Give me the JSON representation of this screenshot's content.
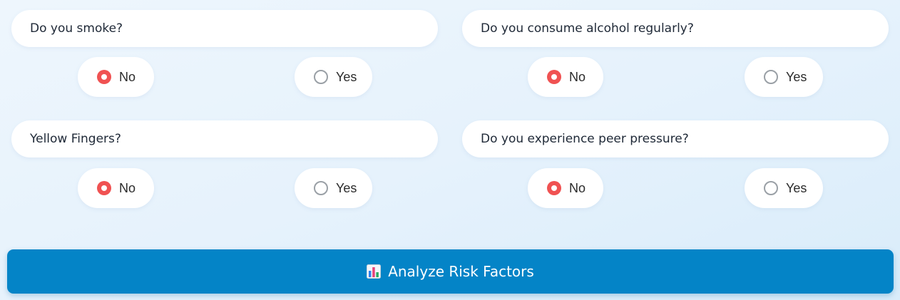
{
  "questions": [
    {
      "label": "Do you smoke?",
      "options": [
        {
          "label": "No",
          "checked": true
        },
        {
          "label": "Yes",
          "checked": false
        }
      ]
    },
    {
      "label": "Do you consume alcohol regularly?",
      "options": [
        {
          "label": "No",
          "checked": true
        },
        {
          "label": "Yes",
          "checked": false
        }
      ]
    },
    {
      "label": "Yellow Fingers?",
      "options": [
        {
          "label": "No",
          "checked": true
        },
        {
          "label": "Yes",
          "checked": false
        }
      ]
    },
    {
      "label": "Do you experience peer pressure?",
      "options": [
        {
          "label": "No",
          "checked": true
        },
        {
          "label": "Yes",
          "checked": false
        }
      ]
    }
  ],
  "analyze_button": {
    "label": "Analyze Risk Factors",
    "icon": "bar-chart-icon"
  },
  "colors": {
    "accent": "#0484c7",
    "radio_checked": "#f05252",
    "radio_unchecked": "#9aa0a6"
  }
}
